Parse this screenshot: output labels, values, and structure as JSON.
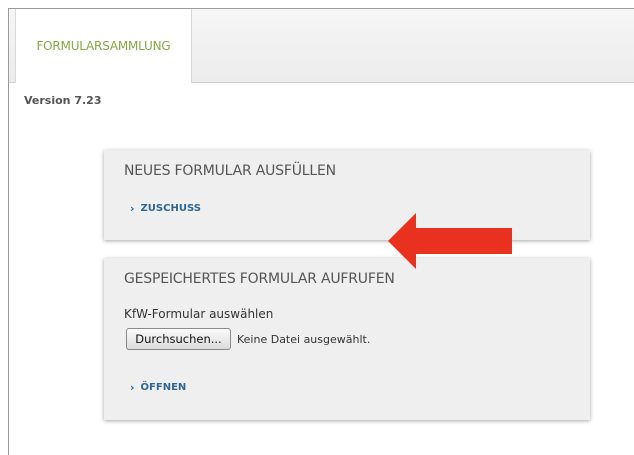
{
  "header": {
    "tab_label": "FORMULARSAMMLUNG"
  },
  "version": "Version 7.23",
  "new_form": {
    "title": "NEUES FORMULAR AUSFÜLLEN",
    "link_label": "ZUSCHUSS"
  },
  "saved_form": {
    "title": "GESPEICHERTES FORMULAR AUFRUFEN",
    "field_label": "KfW-Formular auswählen",
    "browse_button": "Durchsuchen...",
    "file_status": "Keine Datei ausgewählt.",
    "link_label": "ÖFFNEN"
  },
  "colors": {
    "tab_text": "#86a845",
    "link": "#2e6693",
    "arrow": "#e8321f"
  },
  "icons": {
    "link_chevron": "chevron-right-icon",
    "annotation": "red-arrow-left-icon"
  }
}
